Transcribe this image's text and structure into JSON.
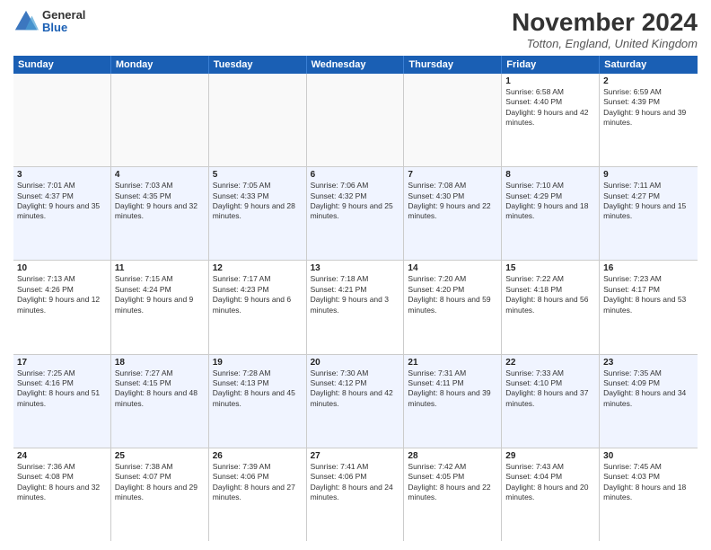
{
  "logo": {
    "general": "General",
    "blue": "Blue"
  },
  "header": {
    "month": "November 2024",
    "location": "Totton, England, United Kingdom"
  },
  "days": [
    "Sunday",
    "Monday",
    "Tuesday",
    "Wednesday",
    "Thursday",
    "Friday",
    "Saturday"
  ],
  "rows": [
    [
      {
        "day": "",
        "empty": true
      },
      {
        "day": "",
        "empty": true
      },
      {
        "day": "",
        "empty": true
      },
      {
        "day": "",
        "empty": true
      },
      {
        "day": "",
        "empty": true
      },
      {
        "day": "1",
        "sunrise": "Sunrise: 6:58 AM",
        "sunset": "Sunset: 4:40 PM",
        "daylight": "Daylight: 9 hours and 42 minutes."
      },
      {
        "day": "2",
        "sunrise": "Sunrise: 6:59 AM",
        "sunset": "Sunset: 4:39 PM",
        "daylight": "Daylight: 9 hours and 39 minutes."
      }
    ],
    [
      {
        "day": "3",
        "sunrise": "Sunrise: 7:01 AM",
        "sunset": "Sunset: 4:37 PM",
        "daylight": "Daylight: 9 hours and 35 minutes."
      },
      {
        "day": "4",
        "sunrise": "Sunrise: 7:03 AM",
        "sunset": "Sunset: 4:35 PM",
        "daylight": "Daylight: 9 hours and 32 minutes."
      },
      {
        "day": "5",
        "sunrise": "Sunrise: 7:05 AM",
        "sunset": "Sunset: 4:33 PM",
        "daylight": "Daylight: 9 hours and 28 minutes."
      },
      {
        "day": "6",
        "sunrise": "Sunrise: 7:06 AM",
        "sunset": "Sunset: 4:32 PM",
        "daylight": "Daylight: 9 hours and 25 minutes."
      },
      {
        "day": "7",
        "sunrise": "Sunrise: 7:08 AM",
        "sunset": "Sunset: 4:30 PM",
        "daylight": "Daylight: 9 hours and 22 minutes."
      },
      {
        "day": "8",
        "sunrise": "Sunrise: 7:10 AM",
        "sunset": "Sunset: 4:29 PM",
        "daylight": "Daylight: 9 hours and 18 minutes."
      },
      {
        "day": "9",
        "sunrise": "Sunrise: 7:11 AM",
        "sunset": "Sunset: 4:27 PM",
        "daylight": "Daylight: 9 hours and 15 minutes."
      }
    ],
    [
      {
        "day": "10",
        "sunrise": "Sunrise: 7:13 AM",
        "sunset": "Sunset: 4:26 PM",
        "daylight": "Daylight: 9 hours and 12 minutes."
      },
      {
        "day": "11",
        "sunrise": "Sunrise: 7:15 AM",
        "sunset": "Sunset: 4:24 PM",
        "daylight": "Daylight: 9 hours and 9 minutes."
      },
      {
        "day": "12",
        "sunrise": "Sunrise: 7:17 AM",
        "sunset": "Sunset: 4:23 PM",
        "daylight": "Daylight: 9 hours and 6 minutes."
      },
      {
        "day": "13",
        "sunrise": "Sunrise: 7:18 AM",
        "sunset": "Sunset: 4:21 PM",
        "daylight": "Daylight: 9 hours and 3 minutes."
      },
      {
        "day": "14",
        "sunrise": "Sunrise: 7:20 AM",
        "sunset": "Sunset: 4:20 PM",
        "daylight": "Daylight: 8 hours and 59 minutes."
      },
      {
        "day": "15",
        "sunrise": "Sunrise: 7:22 AM",
        "sunset": "Sunset: 4:18 PM",
        "daylight": "Daylight: 8 hours and 56 minutes."
      },
      {
        "day": "16",
        "sunrise": "Sunrise: 7:23 AM",
        "sunset": "Sunset: 4:17 PM",
        "daylight": "Daylight: 8 hours and 53 minutes."
      }
    ],
    [
      {
        "day": "17",
        "sunrise": "Sunrise: 7:25 AM",
        "sunset": "Sunset: 4:16 PM",
        "daylight": "Daylight: 8 hours and 51 minutes."
      },
      {
        "day": "18",
        "sunrise": "Sunrise: 7:27 AM",
        "sunset": "Sunset: 4:15 PM",
        "daylight": "Daylight: 8 hours and 48 minutes."
      },
      {
        "day": "19",
        "sunrise": "Sunrise: 7:28 AM",
        "sunset": "Sunset: 4:13 PM",
        "daylight": "Daylight: 8 hours and 45 minutes."
      },
      {
        "day": "20",
        "sunrise": "Sunrise: 7:30 AM",
        "sunset": "Sunset: 4:12 PM",
        "daylight": "Daylight: 8 hours and 42 minutes."
      },
      {
        "day": "21",
        "sunrise": "Sunrise: 7:31 AM",
        "sunset": "Sunset: 4:11 PM",
        "daylight": "Daylight: 8 hours and 39 minutes."
      },
      {
        "day": "22",
        "sunrise": "Sunrise: 7:33 AM",
        "sunset": "Sunset: 4:10 PM",
        "daylight": "Daylight: 8 hours and 37 minutes."
      },
      {
        "day": "23",
        "sunrise": "Sunrise: 7:35 AM",
        "sunset": "Sunset: 4:09 PM",
        "daylight": "Daylight: 8 hours and 34 minutes."
      }
    ],
    [
      {
        "day": "24",
        "sunrise": "Sunrise: 7:36 AM",
        "sunset": "Sunset: 4:08 PM",
        "daylight": "Daylight: 8 hours and 32 minutes."
      },
      {
        "day": "25",
        "sunrise": "Sunrise: 7:38 AM",
        "sunset": "Sunset: 4:07 PM",
        "daylight": "Daylight: 8 hours and 29 minutes."
      },
      {
        "day": "26",
        "sunrise": "Sunrise: 7:39 AM",
        "sunset": "Sunset: 4:06 PM",
        "daylight": "Daylight: 8 hours and 27 minutes."
      },
      {
        "day": "27",
        "sunrise": "Sunrise: 7:41 AM",
        "sunset": "Sunset: 4:06 PM",
        "daylight": "Daylight: 8 hours and 24 minutes."
      },
      {
        "day": "28",
        "sunrise": "Sunrise: 7:42 AM",
        "sunset": "Sunset: 4:05 PM",
        "daylight": "Daylight: 8 hours and 22 minutes."
      },
      {
        "day": "29",
        "sunrise": "Sunrise: 7:43 AM",
        "sunset": "Sunset: 4:04 PM",
        "daylight": "Daylight: 8 hours and 20 minutes."
      },
      {
        "day": "30",
        "sunrise": "Sunrise: 7:45 AM",
        "sunset": "Sunset: 4:03 PM",
        "daylight": "Daylight: 8 hours and 18 minutes."
      }
    ]
  ]
}
